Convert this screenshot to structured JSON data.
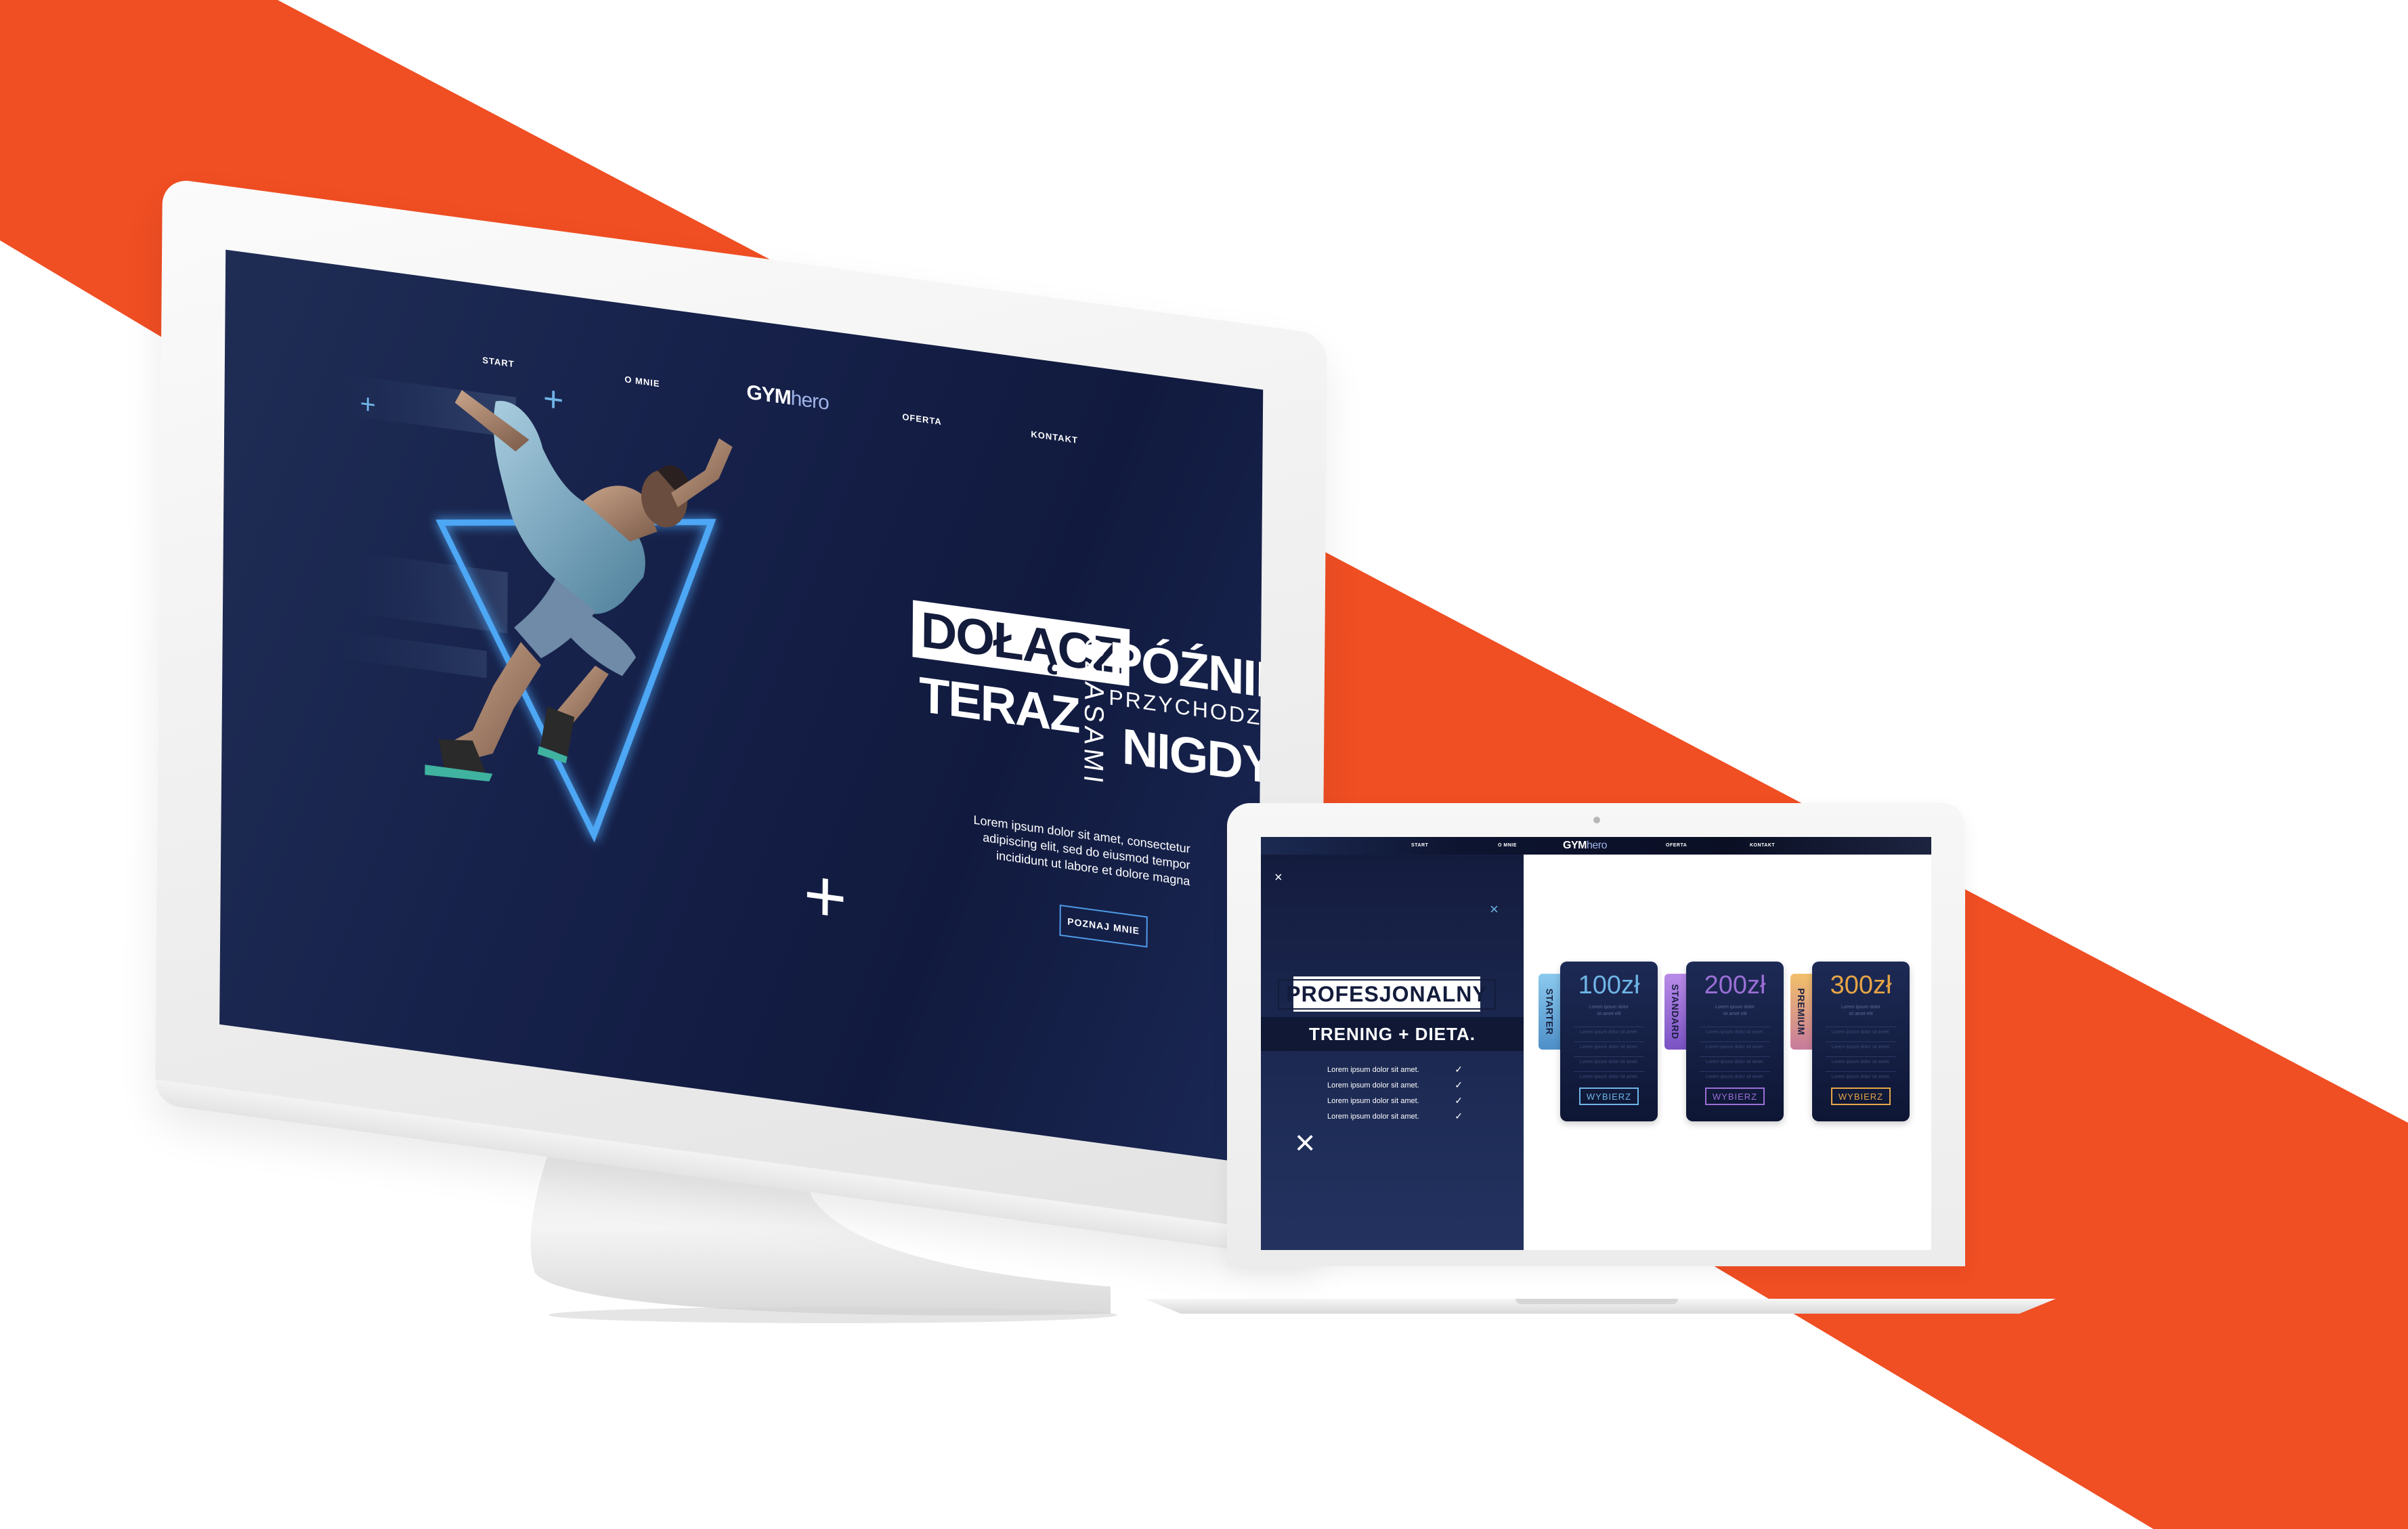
{
  "colors": {
    "accent_orange": "#f04e23",
    "navy": "#16214a",
    "neon_blue": "#4ea7f5"
  },
  "desktop": {
    "nav": {
      "start": "START",
      "o_mnie": "O MNIE",
      "oferta": "OFERTA",
      "kontakt": "KONTAKT"
    },
    "logo": {
      "bold": "GYM",
      "light": "hero"
    },
    "headline": {
      "box_word": "DOŁĄCZ",
      "word_2": "TERAZ",
      "vertical_word": "CZASAMI",
      "word_3": "PÓŹNIEJ",
      "word_4": "PRZYCHODZI",
      "word_5": "NIGDY."
    },
    "lorem_lines": [
      "Lorem ipsum dolor sit amet, consectetur",
      "adipiscing elit, sed do eiusmod tempor",
      "incididunt ut labore et dolore magna"
    ],
    "cta_label": "POZNAJ MNIE",
    "image": "sprinter-athlete-with-neon-triangle"
  },
  "laptop": {
    "nav": {
      "start": "START",
      "o_mnie": "O MNIE",
      "oferta": "OFERTA",
      "kontakt": "KONTAKT"
    },
    "logo": {
      "bold": "GYM",
      "light": "hero"
    },
    "title": "PROFESJONALNY",
    "subtitle": "TRENING + DIETA.",
    "list": [
      "Lorem ipsum dolor sit amet.",
      "Lorem ipsum dolor sit amet.",
      "Lorem ipsum dolor sit amet.",
      "Lorem ipsum dolor sit amet."
    ],
    "plans": [
      {
        "name": "STARTER",
        "price": "100zł",
        "button": "WYBIERZ",
        "color": "#6fb4e6"
      },
      {
        "name": "STANDARD",
        "price": "200zł",
        "button": "WYBIERZ",
        "color": "#9a6fd6"
      },
      {
        "name": "PREMIUM",
        "price": "300zł",
        "button": "WYBIERZ",
        "color": "#e7a546"
      }
    ],
    "plan_small_lines": [
      "Lorem ipsum dolor",
      "sit amet elit"
    ],
    "plan_row_text": "Lorem ipsum dolor sit amet."
  }
}
